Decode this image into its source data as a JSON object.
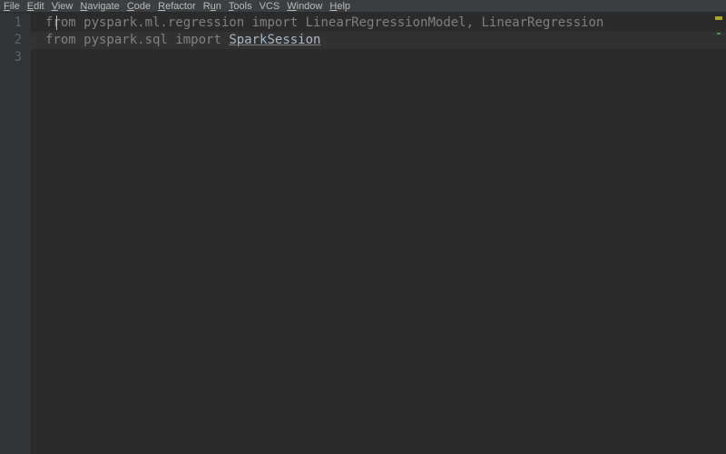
{
  "menu": {
    "file": "File",
    "edit": "Edit",
    "view": "View",
    "navigate": "Navigate",
    "code": "Code",
    "refactor": "Refactor",
    "run": "Run",
    "tools": "Tools",
    "vcs": "VCS",
    "window": "Window",
    "help": "Help"
  },
  "gutter": {
    "l1": "1",
    "l2": "2",
    "l3": "3"
  },
  "code": {
    "line1": {
      "kw1": "from",
      "mod": " pyspark.ml.regression ",
      "kw2": "import",
      "imports": " LinearRegressionModel, LinearRegression"
    },
    "line2": {
      "kw1": "from",
      "mod": " pyspark.sql ",
      "kw2": "import",
      "sp": " ",
      "cls": "SparkSession"
    }
  }
}
